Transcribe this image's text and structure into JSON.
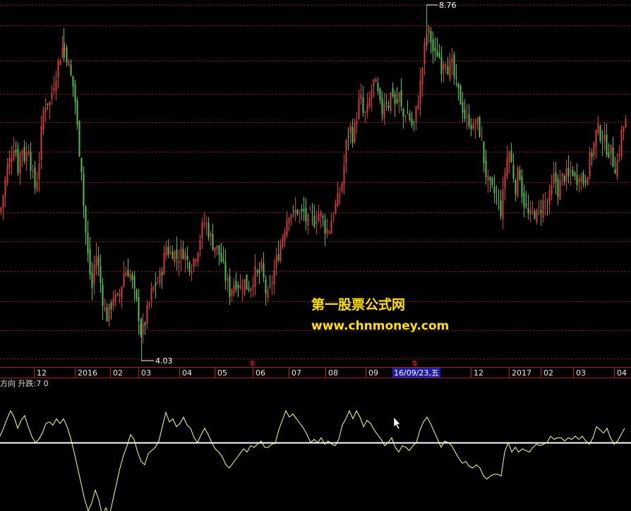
{
  "colors": {
    "background": "#000000",
    "grid": "#8a1f2a",
    "up_candle": "#d63a3a",
    "down_candle": "#4fbf4f",
    "axis_band_border": "#b01e2e",
    "indicator_line": "#ffff99",
    "zero_line": "#ffffff",
    "signal_marker": "#e11c1c",
    "cursor_date_bg": "#1c1ca8",
    "watermark": "#ffe000"
  },
  "watermark": {
    "line1": "第一股票公式网",
    "line2": "www.chnmoney.com"
  },
  "indicator": {
    "title": "方向 升跌:7 0"
  },
  "cursor": {
    "date_label": "16/09/23,五"
  },
  "chart_data": [
    {
      "type": "candlestick",
      "title": "",
      "x_tick_labels": [
        "12",
        "2016",
        "02",
        "03",
        "04",
        "05",
        "06",
        "07",
        "08",
        "09",
        "16/09/23,五",
        "12",
        "2017",
        "02",
        "03",
        "04"
      ],
      "annotations": [
        {
          "text": "8.76",
          "kind": "period-high"
        },
        {
          "text": "4.03",
          "kind": "period-low"
        }
      ],
      "signal_markers": [
        "S",
        "S"
      ],
      "price_path": [
        [
          0,
          6.0
        ],
        [
          5,
          6.3
        ],
        [
          10,
          6.6
        ],
        [
          15,
          6.75
        ],
        [
          20,
          6.95
        ],
        [
          25,
          6.6
        ],
        [
          30,
          6.9
        ],
        [
          35,
          6.7
        ],
        [
          40,
          6.9
        ],
        [
          45,
          6.5
        ],
        [
          50,
          6.3
        ],
        [
          55,
          6.7
        ],
        [
          60,
          7.3
        ],
        [
          65,
          7.5
        ],
        [
          70,
          7.45
        ],
        [
          75,
          7.7
        ],
        [
          80,
          7.9
        ],
        [
          85,
          8.1
        ],
        [
          90,
          8.25
        ],
        [
          95,
          8.05
        ],
        [
          100,
          7.8
        ],
        [
          105,
          7.6
        ],
        [
          110,
          7.0
        ],
        [
          115,
          6.6
        ],
        [
          118,
          6.1
        ],
        [
          122,
          5.6
        ],
        [
          126,
          5.25
        ],
        [
          130,
          5.0
        ],
        [
          135,
          5.5
        ],
        [
          140,
          5.2
        ],
        [
          145,
          4.85
        ],
        [
          150,
          4.6
        ],
        [
          155,
          4.7
        ],
        [
          160,
          4.9
        ],
        [
          165,
          4.8
        ],
        [
          170,
          4.95
        ],
        [
          175,
          5.2
        ],
        [
          180,
          5.25
        ],
        [
          185,
          5.15
        ],
        [
          190,
          4.9
        ],
        [
          195,
          4.7
        ],
        [
          200,
          4.35
        ],
        [
          205,
          4.55
        ],
        [
          210,
          4.75
        ],
        [
          215,
          4.95
        ],
        [
          220,
          5.05
        ],
        [
          225,
          5.1
        ],
        [
          230,
          5.3
        ],
        [
          235,
          5.55
        ],
        [
          240,
          5.45
        ],
        [
          245,
          5.5
        ],
        [
          250,
          5.4
        ],
        [
          255,
          5.45
        ],
        [
          260,
          5.5
        ],
        [
          265,
          5.35
        ],
        [
          270,
          5.3
        ],
        [
          275,
          5.4
        ],
        [
          280,
          5.55
        ],
        [
          285,
          5.75
        ],
        [
          290,
          5.9
        ],
        [
          295,
          5.75
        ],
        [
          300,
          5.6
        ],
        [
          305,
          5.55
        ],
        [
          310,
          5.45
        ],
        [
          315,
          5.3
        ],
        [
          320,
          5.1
        ],
        [
          325,
          4.95
        ],
        [
          330,
          5.05
        ],
        [
          335,
          5.1
        ],
        [
          340,
          5.0
        ],
        [
          345,
          5.1
        ],
        [
          350,
          5.0
        ],
        [
          355,
          5.05
        ],
        [
          360,
          5.2
        ],
        [
          365,
          5.15
        ],
        [
          370,
          5.25
        ],
        [
          375,
          5.0
        ],
        [
          378,
          4.85
        ],
        [
          382,
          4.95
        ],
        [
          385,
          5.1
        ],
        [
          390,
          5.3
        ],
        [
          395,
          5.5
        ],
        [
          400,
          5.7
        ],
        [
          405,
          5.9
        ],
        [
          410,
          6.05
        ],
        [
          415,
          5.95
        ],
        [
          420,
          6.05
        ],
        [
          425,
          5.95
        ],
        [
          430,
          6.0
        ],
        [
          435,
          5.85
        ],
        [
          440,
          5.95
        ],
        [
          445,
          5.9
        ],
        [
          450,
          6.0
        ],
        [
          455,
          5.95
        ],
        [
          460,
          5.8
        ],
        [
          465,
          5.75
        ],
        [
          470,
          5.95
        ],
        [
          475,
          6.1
        ],
        [
          480,
          6.2
        ],
        [
          485,
          6.45
        ],
        [
          490,
          6.9
        ],
        [
          495,
          7.15
        ],
        [
          500,
          7.0
        ],
        [
          505,
          7.3
        ],
        [
          510,
          7.55
        ],
        [
          515,
          7.25
        ],
        [
          520,
          7.35
        ],
        [
          525,
          7.6
        ],
        [
          530,
          7.75
        ],
        [
          535,
          7.55
        ],
        [
          540,
          7.3
        ],
        [
          545,
          7.55
        ],
        [
          550,
          7.45
        ],
        [
          555,
          7.65
        ],
        [
          560,
          7.4
        ],
        [
          565,
          7.55
        ],
        [
          570,
          7.25
        ],
        [
          575,
          7.35
        ],
        [
          580,
          7.25
        ],
        [
          585,
          7.1
        ],
        [
          590,
          7.4
        ],
        [
          595,
          7.7
        ],
        [
          600,
          8.1
        ],
        [
          605,
          8.45
        ],
        [
          610,
          8.3
        ],
        [
          615,
          8.05
        ],
        [
          620,
          8.15
        ],
        [
          625,
          7.95
        ],
        [
          630,
          8.1
        ],
        [
          635,
          7.9
        ],
        [
          640,
          7.95
        ],
        [
          645,
          7.7
        ],
        [
          650,
          7.55
        ],
        [
          655,
          7.4
        ],
        [
          660,
          7.2
        ],
        [
          665,
          7.25
        ],
        [
          670,
          7.1
        ],
        [
          675,
          7.2
        ],
        [
          680,
          7.05
        ],
        [
          685,
          6.7
        ],
        [
          690,
          6.4
        ],
        [
          695,
          6.3
        ],
        [
          700,
          6.25
        ],
        [
          705,
          6.15
        ],
        [
          710,
          6.0
        ],
        [
          715,
          6.55
        ],
        [
          720,
          6.85
        ],
        [
          725,
          6.6
        ],
        [
          730,
          6.35
        ],
        [
          735,
          6.6
        ],
        [
          740,
          6.2
        ],
        [
          745,
          6.05
        ],
        [
          750,
          5.9
        ],
        [
          755,
          6.05
        ],
        [
          760,
          5.95
        ],
        [
          765,
          6.05
        ],
        [
          770,
          6.15
        ],
        [
          775,
          6.1
        ],
        [
          780,
          6.25
        ],
        [
          785,
          6.5
        ],
        [
          790,
          6.3
        ],
        [
          795,
          6.45
        ],
        [
          800,
          6.5
        ],
        [
          805,
          6.45
        ],
        [
          810,
          6.6
        ],
        [
          815,
          6.4
        ],
        [
          820,
          6.55
        ],
        [
          825,
          6.4
        ],
        [
          830,
          6.5
        ],
        [
          835,
          6.7
        ],
        [
          840,
          6.85
        ],
        [
          845,
          7.1
        ],
        [
          850,
          7.05
        ],
        [
          855,
          6.95
        ],
        [
          860,
          6.85
        ],
        [
          865,
          6.8
        ],
        [
          870,
          6.6
        ],
        [
          875,
          6.7
        ],
        [
          880,
          7.05
        ],
        [
          885,
          7.2
        ]
      ]
    },
    {
      "type": "line",
      "title": "方向 升跌:7 0",
      "series_path": [
        [
          0,
          0.4
        ],
        [
          5,
          0.9
        ],
        [
          10,
          1.5
        ],
        [
          15,
          2.0
        ],
        [
          20,
          1.6
        ],
        [
          25,
          0.9
        ],
        [
          30,
          1.4
        ],
        [
          35,
          1.7
        ],
        [
          40,
          1.0
        ],
        [
          45,
          0.4
        ],
        [
          50,
          0.0
        ],
        [
          55,
          0.2
        ],
        [
          60,
          0.6
        ],
        [
          65,
          1.2
        ],
        [
          70,
          1.3
        ],
        [
          75,
          1.1
        ],
        [
          80,
          1.5
        ],
        [
          85,
          1.2
        ],
        [
          90,
          1.5
        ],
        [
          95,
          1.0
        ],
        [
          100,
          0.3
        ],
        [
          105,
          -0.6
        ],
        [
          110,
          -1.6
        ],
        [
          115,
          -2.6
        ],
        [
          120,
          -3.6
        ],
        [
          125,
          -4.3
        ],
        [
          130,
          -3.8
        ],
        [
          135,
          -3.0
        ],
        [
          140,
          -3.6
        ],
        [
          145,
          -4.6
        ],
        [
          150,
          -4.1
        ],
        [
          155,
          -4.6
        ],
        [
          160,
          -3.6
        ],
        [
          165,
          -2.6
        ],
        [
          170,
          -1.6
        ],
        [
          175,
          -0.8
        ],
        [
          180,
          -0.2
        ],
        [
          185,
          0.5
        ],
        [
          190,
          0.2
        ],
        [
          195,
          -0.6
        ],
        [
          200,
          -1.2
        ],
        [
          205,
          -1.4
        ],
        [
          210,
          -0.7
        ],
        [
          215,
          -0.5
        ],
        [
          220,
          -0.3
        ],
        [
          225,
          0.1
        ],
        [
          230,
          1.0
        ],
        [
          235,
          1.9
        ],
        [
          240,
          1.3
        ],
        [
          245,
          1.5
        ],
        [
          250,
          1.0
        ],
        [
          255,
          1.2
        ],
        [
          260,
          1.6
        ],
        [
          265,
          1.1
        ],
        [
          270,
          0.9
        ],
        [
          275,
          0.3
        ],
        [
          280,
          0.0
        ],
        [
          285,
          0.5
        ],
        [
          290,
          0.9
        ],
        [
          295,
          0.5
        ],
        [
          300,
          0.0
        ],
        [
          305,
          -0.4
        ],
        [
          310,
          -0.6
        ],
        [
          315,
          -0.9
        ],
        [
          320,
          -1.4
        ],
        [
          325,
          -1.6
        ],
        [
          330,
          -1.3
        ],
        [
          335,
          -1.0
        ],
        [
          340,
          -0.7
        ],
        [
          345,
          -0.4
        ],
        [
          350,
          -0.6
        ],
        [
          355,
          -0.2
        ],
        [
          360,
          -0.3
        ],
        [
          365,
          -0.1
        ],
        [
          370,
          0.1
        ],
        [
          375,
          -0.3
        ],
        [
          380,
          -0.3
        ],
        [
          385,
          -0.1
        ],
        [
          390,
          -0.05
        ],
        [
          395,
          0.8
        ],
        [
          400,
          1.4
        ],
        [
          405,
          2.0
        ],
        [
          410,
          1.6
        ],
        [
          415,
          1.8
        ],
        [
          420,
          1.5
        ],
        [
          425,
          1.2
        ],
        [
          430,
          0.9
        ],
        [
          435,
          0.5
        ],
        [
          440,
          0.0
        ],
        [
          445,
          0.2
        ],
        [
          450,
          0.0
        ],
        [
          455,
          0.3
        ],
        [
          460,
          -0.1
        ],
        [
          465,
          0.1
        ],
        [
          470,
          -0.1
        ],
        [
          475,
          -0.2
        ],
        [
          480,
          0.2
        ],
        [
          485,
          1.1
        ],
        [
          490,
          1.5
        ],
        [
          495,
          2.0
        ],
        [
          500,
          1.5
        ],
        [
          505,
          2.0
        ],
        [
          510,
          1.6
        ],
        [
          515,
          1.0
        ],
        [
          520,
          1.4
        ],
        [
          525,
          1.2
        ],
        [
          530,
          0.8
        ],
        [
          535,
          0.5
        ],
        [
          540,
          0.2
        ],
        [
          545,
          -0.2
        ],
        [
          550,
          0.0
        ],
        [
          555,
          0.3
        ],
        [
          560,
          -0.3
        ],
        [
          565,
          -0.6
        ],
        [
          570,
          -0.2
        ],
        [
          575,
          -0.3
        ],
        [
          580,
          -0.5
        ],
        [
          585,
          -0.2
        ],
        [
          590,
          0.0
        ],
        [
          595,
          0.8
        ],
        [
          600,
          1.3
        ],
        [
          605,
          1.6
        ],
        [
          610,
          1.2
        ],
        [
          615,
          0.7
        ],
        [
          620,
          0.2
        ],
        [
          625,
          -0.3
        ],
        [
          630,
          0.1
        ],
        [
          635,
          0.0
        ],
        [
          640,
          -0.2
        ],
        [
          645,
          -0.6
        ],
        [
          650,
          -1.0
        ],
        [
          655,
          -1.3
        ],
        [
          660,
          -1.2
        ],
        [
          665,
          -1.5
        ],
        [
          670,
          -1.6
        ],
        [
          675,
          -1.4
        ],
        [
          680,
          -1.6
        ],
        [
          685,
          -2.1
        ],
        [
          690,
          -2.3
        ],
        [
          695,
          -2.1
        ],
        [
          700,
          -2.0
        ],
        [
          705,
          -2.0
        ],
        [
          710,
          -2.1
        ],
        [
          715,
          -0.6
        ],
        [
          720,
          0.0
        ],
        [
          725,
          -0.6
        ],
        [
          730,
          -0.3
        ],
        [
          735,
          -0.6
        ],
        [
          740,
          -0.4
        ],
        [
          745,
          -0.5
        ],
        [
          750,
          -0.6
        ],
        [
          755,
          -0.3
        ],
        [
          760,
          -0.1
        ],
        [
          765,
          -0.2
        ],
        [
          770,
          -0.1
        ],
        [
          775,
          0.0
        ],
        [
          780,
          0.4
        ],
        [
          785,
          0.2
        ],
        [
          790,
          0.3
        ],
        [
          795,
          0.3
        ],
        [
          800,
          0.1
        ],
        [
          805,
          0.3
        ],
        [
          810,
          0.2
        ],
        [
          815,
          0.4
        ],
        [
          820,
          0.2
        ],
        [
          825,
          0.4
        ],
        [
          830,
          0.1
        ],
        [
          835,
          -0.1
        ],
        [
          840,
          0.3
        ],
        [
          845,
          1.0
        ],
        [
          850,
          0.8
        ],
        [
          855,
          0.6
        ],
        [
          860,
          0.9
        ],
        [
          865,
          0.3
        ],
        [
          870,
          -0.1
        ],
        [
          875,
          0.1
        ],
        [
          880,
          0.5
        ],
        [
          885,
          0.9
        ]
      ]
    }
  ]
}
